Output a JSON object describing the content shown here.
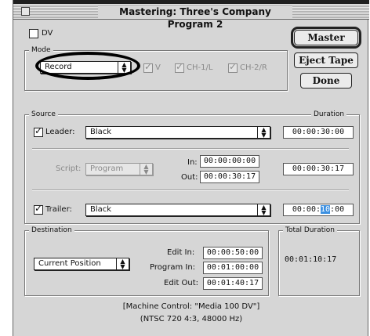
{
  "window": {
    "title": "Mastering: Three's Company Program 2"
  },
  "top": {
    "checkbox_label": "DV"
  },
  "mode": {
    "group_title": "Mode",
    "popup_value": "Record",
    "channels": [
      {
        "label": "V",
        "checked": true
      },
      {
        "label": "CH-1/L",
        "checked": true
      },
      {
        "label": "CH-2/R",
        "checked": true
      }
    ]
  },
  "buttons": {
    "master": "Master",
    "eject": "Eject Tape",
    "done": "Done"
  },
  "source": {
    "group_title": "Source",
    "duration_header": "Duration",
    "leader": {
      "label": "Leader:",
      "checked": true,
      "popup_value": "Black",
      "duration": "00:00:30:00"
    },
    "script": {
      "label": "Script:",
      "popup_value": "Program",
      "in_label": "In:",
      "in_value": "00:00:00:00",
      "out_label": "Out:",
      "out_value": "00:00:30:17",
      "duration": "00:00:30:17"
    },
    "trailer": {
      "label": "Trailer:",
      "checked": true,
      "popup_value": "Black",
      "duration_prefix": "00:00:",
      "duration_highlight": "10",
      "duration_suffix": ":00"
    }
  },
  "destination": {
    "group_title": "Destination",
    "popup_value": "Current Position",
    "edit_in_label": "Edit In:",
    "edit_in_value": "00:00:50:00",
    "program_in_label": "Program In:",
    "program_in_value": "00:01:00:00",
    "edit_out_label": "Edit Out:",
    "edit_out_value": "00:01:40:17"
  },
  "total_duration": {
    "group_title": "Total Duration",
    "value": "00:01:10:17"
  },
  "footer": {
    "line1": "[Machine Control: \"Media 100 DV\"]",
    "line2": "(NTSC 720 4:3, 48000 Hz)"
  }
}
